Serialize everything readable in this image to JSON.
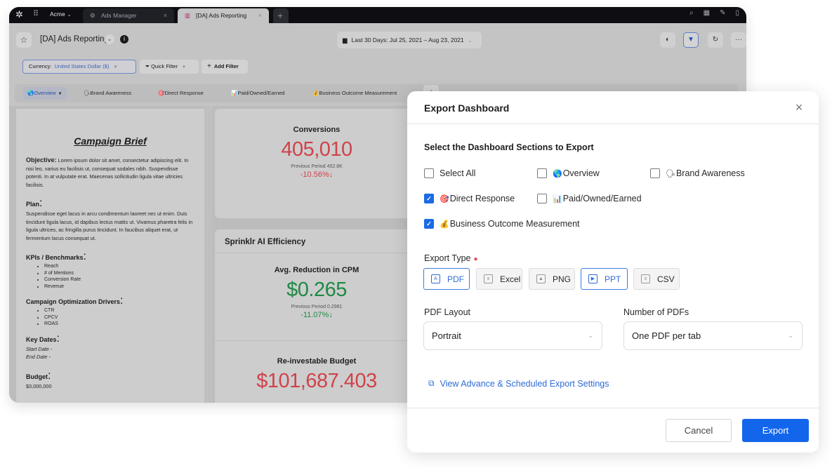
{
  "browser": {
    "org": "Acme",
    "tabs": [
      {
        "label": "Ads Manager",
        "active": false
      },
      {
        "label": "[DA] Ads Reporting",
        "active": true
      }
    ],
    "new_tab": "+",
    "close": "×"
  },
  "header": {
    "title": "[DA] Ads Reporting",
    "date_range": "Last 30 Days: Jul 25, 2021 – Aug 23, 2021"
  },
  "filters": {
    "currency_label": "Currency:",
    "currency_value": "United States Dollar ($)",
    "quick_filter": "Quick Filter",
    "add_filter": "Add Filter"
  },
  "dashboard_tabs": [
    {
      "emoji": "🌎",
      "label": "Overview",
      "active": true
    },
    {
      "emoji": "🗣",
      "label": "Brand Awareness",
      "active": false
    },
    {
      "emoji": "🎯",
      "label": "Direct Response",
      "active": false
    },
    {
      "emoji": "📊",
      "label": "Paid/Owned/Earned",
      "active": false
    },
    {
      "emoji": "💰",
      "label": "Business Outcome Measurement",
      "active": false
    }
  ],
  "brief": {
    "title": "Campaign Brief",
    "objective_label": "Objective:",
    "objective_text": "Lorem ipsum dolor sit amet, consectetur adipiscing elit. In nisi leo, varius eu facilisis ut, consequat sodales nibh. Suspendisse potenti. In at vulputate erat. Maecenas sollicitudin ligula vitae ultricies facilisis.",
    "plan_label": "Plan",
    "plan_text": "Suspendisse eget lacus in arcu condimentum laoreet nec ut enim. Duis tincidunt ligula lacus, id dapibus lectus mattis ut. Vivamus pharetra felis in ligula ultrices, ac fringilla purus tincidunt. In faucibus aliquet erat, ut fermentum lacus consequat ut.",
    "kpis_label": "KPIs / Benchmarks",
    "kpis": [
      "Reach",
      "# of Mentions",
      "Conversion Rate",
      "Revenue"
    ],
    "drivers_label": "Campaign Optimization Drivers",
    "drivers": [
      "CTR",
      "CPCV",
      "ROAS"
    ],
    "dates_label": "Key Dates",
    "start_date": "Start Date -",
    "end_date": "End Date -",
    "budget_label": "Budget",
    "budget_value": "$3,000,000"
  },
  "metrics": {
    "conversions": {
      "title": "Conversions",
      "value": "405,010",
      "previous": "Previous Period 452.8K",
      "change": "-10.56%↓"
    },
    "ai_section_title": "Sprinklr AI Efficiency",
    "cpm": {
      "title": "Avg. Reduction in CPM",
      "value": "$0.265",
      "previous": "Previous Period 0.2981",
      "change": "-11.07%↓"
    },
    "budget": {
      "title": "Re-investable Budget",
      "value": "$101,687.403"
    }
  },
  "modal": {
    "title": "Export Dashboard",
    "subtitle": "Select the Dashboard Sections to Export",
    "sections": [
      {
        "label": "Select All",
        "emoji": "",
        "checked": false
      },
      {
        "label": "Overview",
        "emoji": "🌎",
        "checked": false
      },
      {
        "label": "Brand Awareness",
        "emoji": "🗣",
        "checked": false
      },
      {
        "label": "Direct Response",
        "emoji": "🎯",
        "checked": true
      },
      {
        "label": "Paid/Owned/Earned",
        "emoji": "📊",
        "checked": false
      },
      {
        "label": "Business Outcome Measurement",
        "emoji": "💰",
        "checked": true
      }
    ],
    "export_type_label": "Export Type",
    "export_types": [
      {
        "label": "PDF",
        "selected": true
      },
      {
        "label": "Excel",
        "selected": false
      },
      {
        "label": "PNG",
        "selected": false
      },
      {
        "label": "PPT",
        "selected": true
      },
      {
        "label": "CSV",
        "selected": false
      }
    ],
    "pdf_layout_label": "PDF Layout",
    "pdf_layout_value": "Portrait",
    "num_pdfs_label": "Number of PDFs",
    "num_pdfs_value": "One PDF per tab",
    "advanced_link": "View Advance & Scheduled Export Settings",
    "cancel": "Cancel",
    "export": "Export"
  },
  "colors": {
    "accent": "#1366ec",
    "negative": "#d0424a",
    "positive": "#1f8a44"
  }
}
